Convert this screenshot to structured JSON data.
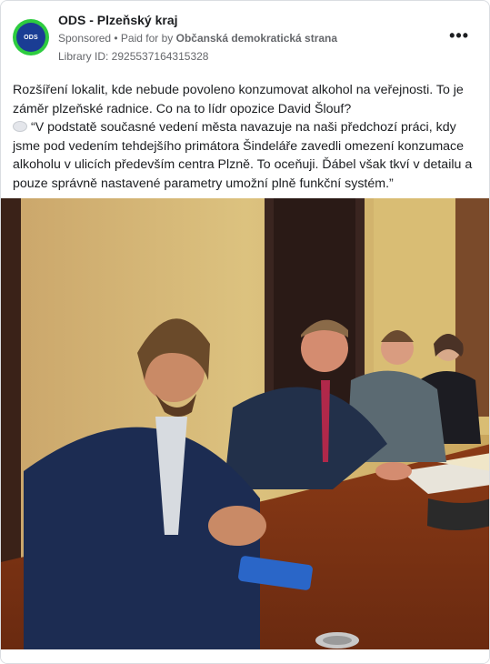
{
  "post": {
    "page_name": "ODS - Plzeňský kraj",
    "avatar_text": "ODS",
    "sponsored": "Sponsored",
    "paid_for_prefix": "• Paid for by",
    "paid_for_by": "Občanská demokratická strana",
    "library_id": "Library ID: 2925537164315328",
    "more_icon": "more-horizontal-icon",
    "paragraph_1": "Rozšíření lokalit, kde nebude povoleno konzumovat alkohol na veřejnosti. To je záměr plzeňské radnice. Co na to lídr opozice David Šlouf?",
    "paragraph_2": "“V podstatě současné vedení města navazuje na naši předchozí práci, kdy jsme pod vedením tehdejšího primátora Šindeláře zavedli omezení konzumace alkoholu v ulicích především centra Plzně. To oceňuji. Ďábel však tkví v detailu a pouze správně nastavené parametry umožní plně funkční systém.”",
    "speech_icon": "speech-balloon-icon"
  },
  "colors": {
    "avatar_ring": "#2ecc40",
    "avatar_fill": "#1a3d94",
    "meta_text": "#65676b",
    "text": "#1c1e21"
  }
}
